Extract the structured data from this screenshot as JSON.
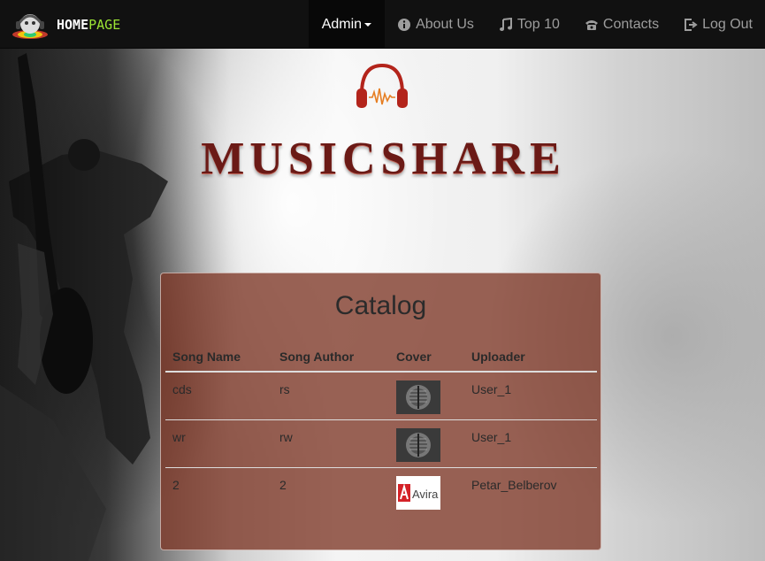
{
  "brand": {
    "home": "HOME",
    "page": "PAGE"
  },
  "nav": {
    "items": [
      {
        "label": "Admin",
        "icon": "dropdown-caret",
        "active": true
      },
      {
        "label": "About Us",
        "icon": "info-sign-icon"
      },
      {
        "label": "Top 10",
        "icon": "music-note-icon"
      },
      {
        "label": "Contacts",
        "icon": "phone-icon"
      },
      {
        "label": "Log Out",
        "icon": "log-out-icon"
      }
    ]
  },
  "header": {
    "title": "MUSICSHARE",
    "logo_icon": "headphones-icon"
  },
  "catalog": {
    "title": "Catalog",
    "columns": [
      "Song Name",
      "Song Author",
      "Cover",
      "Uploader"
    ],
    "rows": [
      {
        "song_name": "cds",
        "song_author": "rs",
        "cover": "metal-drum-cover",
        "uploader": "User_1"
      },
      {
        "song_name": "wr",
        "song_author": "rw",
        "cover": "metal-drum-cover",
        "uploader": "User_1"
      },
      {
        "song_name": "2",
        "song_author": "2",
        "cover": "avira-logo-cover",
        "uploader": "Petar_Belberov",
        "cover_text": "Avira"
      }
    ]
  },
  "colors": {
    "navbar": "#111111",
    "brand_accent": "#9be334",
    "panel": "#7d3726",
    "title": "#6b1a16"
  }
}
